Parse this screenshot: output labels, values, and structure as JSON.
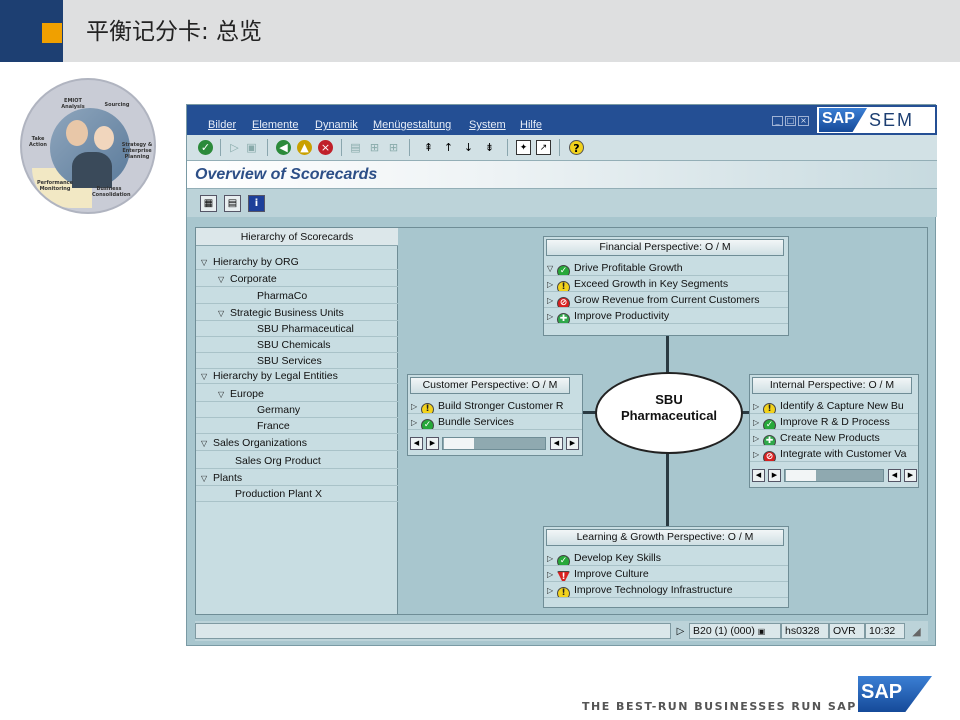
{
  "slide": {
    "title": "平衡记分卡: 总览",
    "tagline": "THE BEST-RUN BUSINESSES RUN SAP",
    "footer_logo": "SAP",
    "accent_navy": "#1d3f72",
    "accent_orange": "#f0a000"
  },
  "value_circle": {
    "segments": [
      "EMIOT Analysis",
      "Sourcing",
      "Strategy & Enterprise Planning",
      "Business Consolidation",
      "Performance Monitoring",
      "Take Action"
    ]
  },
  "sap": {
    "menu": [
      "Bilder",
      "Elemente",
      "Dynamik",
      "Menügestaltung",
      "System",
      "Hilfe"
    ],
    "logo_badge": "SAP",
    "logo_product": "SEM",
    "screen_title": "Overview of Scorecards",
    "toolbar_icons": [
      "check-icon",
      "back-icon",
      "exit-icon",
      "cancel-icon",
      "print-icon",
      "find-icon",
      "find-next-icon",
      "first-page-icon",
      "prev-page-icon",
      "next-page-icon",
      "last-page-icon",
      "new-session-icon",
      "shortcut-icon",
      "help-icon"
    ]
  },
  "tree": {
    "header": "Hierarchy of Scorecards",
    "rows": [
      {
        "label": "Hierarchy by ORG",
        "expandable": true
      },
      {
        "label": "Corporate",
        "expandable": true
      },
      {
        "label": "PharmaCo",
        "expandable": false
      },
      {
        "label": "Strategic Business Units",
        "expandable": true
      },
      {
        "label": "SBU Pharmaceutical",
        "expandable": false
      },
      {
        "label": "SBU Chemicals",
        "expandable": false
      },
      {
        "label": "SBU Services",
        "expandable": false
      },
      {
        "label": "Hierarchy by Legal Entities",
        "expandable": true
      },
      {
        "label": "Europe",
        "expandable": true
      },
      {
        "label": "Germany",
        "expandable": false
      },
      {
        "label": "France",
        "expandable": false
      },
      {
        "label": "Sales Organizations",
        "expandable": true
      },
      {
        "label": "Sales Org Product",
        "expandable": false
      },
      {
        "label": "Plants",
        "expandable": true
      },
      {
        "label": "Production Plant X",
        "expandable": false
      }
    ]
  },
  "center_node": "SBU\nPharmaceutical",
  "perspectives": {
    "financial": {
      "title": "Financial Perspective: O / M",
      "objectives": [
        {
          "label": "Drive Profitable Growth",
          "status": "ok",
          "expanded": true
        },
        {
          "label": "Exceed Growth in Key Segments",
          "status": "warn",
          "expanded": false
        },
        {
          "label": "Grow Revenue from Current Customers",
          "status": "bad",
          "expanded": false
        },
        {
          "label": "Improve Productivity",
          "status": "new",
          "expanded": false
        }
      ]
    },
    "customer": {
      "title": "Customer Perspective: O / M",
      "objectives": [
        {
          "label": "Build Stronger Customer R",
          "status": "warn"
        },
        {
          "label": "Bundle Services",
          "status": "ok"
        }
      ]
    },
    "internal": {
      "title": "Internal Perspective: O / M",
      "objectives": [
        {
          "label": "Identify & Capture New Bu",
          "status": "warn"
        },
        {
          "label": "Improve R & D Process",
          "status": "ok"
        },
        {
          "label": "Create New Products",
          "status": "new"
        },
        {
          "label": "Integrate with Customer Va",
          "status": "bad"
        }
      ]
    },
    "learning": {
      "title": "Learning & Growth Perspective: O / M",
      "objectives": [
        {
          "label": "Develop Key Skills",
          "status": "ok"
        },
        {
          "label": "Improve Culture",
          "status": "alert"
        },
        {
          "label": "Improve Technology Infrastructure",
          "status": "warn"
        }
      ]
    }
  },
  "statusbar": {
    "system": "B20 (1) (000)",
    "server": "hs0328",
    "mode": "OVR",
    "time": "10:32"
  },
  "status_glyphs": {
    "ok": "✓",
    "warn": "!",
    "bad": "⊘",
    "new": "✚",
    "alert": "!"
  }
}
